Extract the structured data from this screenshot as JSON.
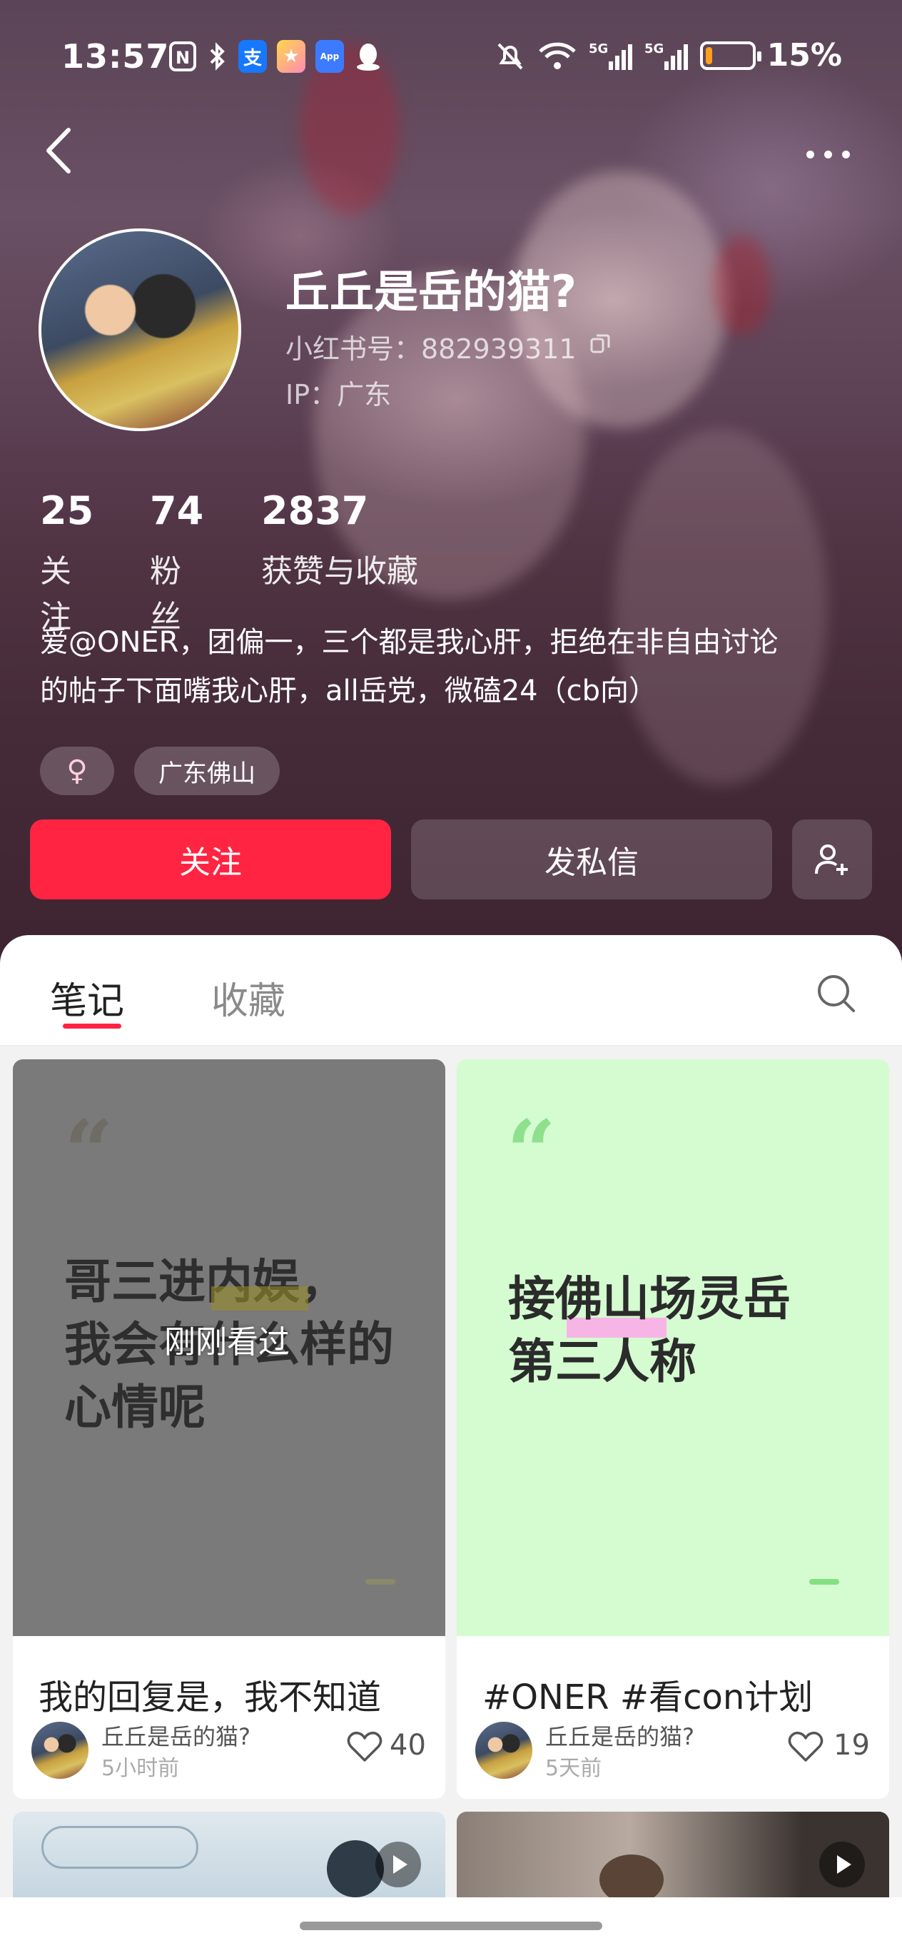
{
  "status_bar": {
    "time": "13:57",
    "icons": [
      "nfc-icon",
      "bluetooth-icon",
      "alipay-icon",
      "app-icon",
      "app-market-icon",
      "qq-icon",
      "mute-icon",
      "wifi-icon",
      "signal-5g-icon",
      "signal-5g-icon"
    ],
    "battery_percent": "15%",
    "battery_level": 0.15
  },
  "profile": {
    "name": "丘丘是岳的猫?",
    "red_id": "小红书号：882939311",
    "ip": "IP：广东",
    "stats": [
      {
        "num": "25",
        "label": "关注"
      },
      {
        "num": "74",
        "label": "粉丝"
      },
      {
        "num": "2837",
        "label": "获赞与收藏"
      }
    ],
    "bio_line1": "爱@ONER，团偏一，三个都是我心肝，拒绝在非自由讨论",
    "bio_line2": "的帖子下面嘴我心肝，all岳党，微磕24（cb向）",
    "gender_symbol": "♀",
    "location_tag": "广东佛山"
  },
  "actions": {
    "follow": "关注",
    "message": "发私信"
  },
  "tabs": {
    "notes": "笔记",
    "collections": "收藏"
  },
  "notes": [
    {
      "cover_line1": "哥三进内娱，",
      "cover_line2": "我会有什么样的",
      "cover_line3": "心情呢",
      "overlay": "刚刚看过",
      "title": "我的回复是，我不知道",
      "author": "丘丘是岳的猫?",
      "time": "5小时前",
      "likes": "40",
      "cover_color": "#7a7a7a"
    },
    {
      "cover_line1": "接佛山场灵岳",
      "cover_line2": "第三人称",
      "title": "#ONER #看con计划",
      "author": "丘丘是岳的猫?",
      "time": "5天前",
      "likes": "19",
      "cover_color": "#d4fcd0"
    }
  ],
  "colors": {
    "accent": "#ff2442"
  }
}
